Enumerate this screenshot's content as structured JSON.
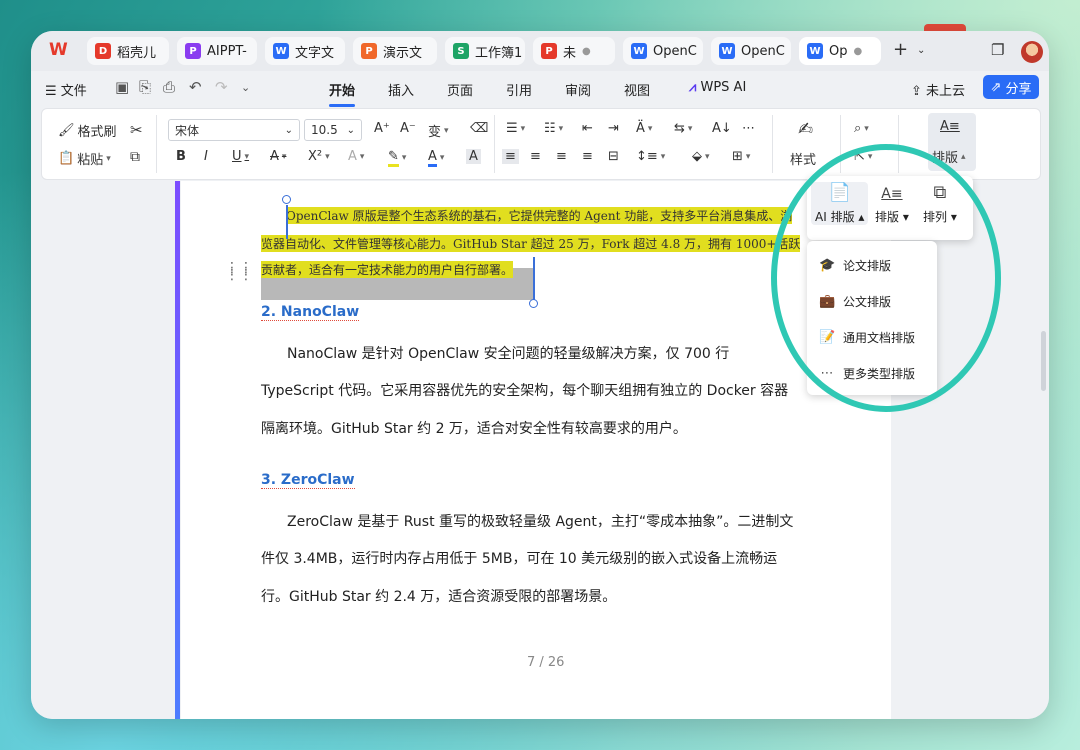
{
  "colors": {
    "accent": "#2a6cf6",
    "highlight": "#e1de1f",
    "annotation_circle": "#2fc8b4"
  },
  "tabs": [
    {
      "label": "稻壳儿",
      "icon": "docer-icon",
      "color": "#e5392b",
      "glyph": "D"
    },
    {
      "label": "AIPPT-",
      "icon": "aippt-icon",
      "color": "#8a3cf0",
      "glyph": "P"
    },
    {
      "label": "文字文",
      "icon": "writer-icon",
      "color": "#2a6cf6",
      "glyph": "W"
    },
    {
      "label": "演示文",
      "icon": "presentation-icon",
      "color": "#f0672a",
      "glyph": "P"
    },
    {
      "label": "工作簿1",
      "icon": "spreadsheet-icon",
      "color": "#1ea466",
      "glyph": "S"
    },
    {
      "label": "未",
      "icon": "pdf-icon",
      "color": "#e5392b",
      "glyph": "P"
    },
    {
      "label": "OpenC",
      "icon": "writer-icon",
      "color": "#2a6cf6",
      "glyph": "W"
    },
    {
      "label": "OpenC",
      "icon": "writer-icon",
      "color": "#2a6cf6",
      "glyph": "W"
    },
    {
      "label": "Op",
      "icon": "writer-icon",
      "color": "#2a6cf6",
      "glyph": "W"
    }
  ],
  "menubar": {
    "file": "文件",
    "items": [
      "开始",
      "插入",
      "页面",
      "引用",
      "审阅",
      "视图"
    ],
    "wps_ai": "WPS AI",
    "cloud": "未上云",
    "share": "分享"
  },
  "ribbon": {
    "format_painter": "格式刷",
    "paste": "粘贴",
    "font": "宋体",
    "font_size": "10.5",
    "style": "样式",
    "typeset": "排版"
  },
  "document": {
    "highlight_lines": [
      "OpenClaw 原版是整个生态系统的基石，它提供完整的 Agent 功能，支持多平台消息集成、浏",
      "览器自动化、文件管理等核心能力。GitHub Star 超过 25 万，Fork 超过 4.8 万，拥有 1000+活跃",
      "贡献者，适合有一定技术能力的用户自行部署。"
    ],
    "h2": "2. NanoClaw",
    "p2": [
      "NanoClaw 是针对 OpenClaw 安全问题的轻量级解决方案，仅 700 行",
      "TypeScript 代码。它采用容器优先的安全架构，每个聊天组拥有独立的 Docker 容器",
      "隔离环境。GitHub Star 约 2 万，适合对安全性有较高要求的用户。"
    ],
    "h3": "3. ZeroClaw",
    "p3": [
      "ZeroClaw 是基于 Rust 重写的极致轻量级 Agent，主打“零成本抽象”。二进制文",
      "件仅 3.4MB，运行时内存占用低于 5MB，可在 10 美元级别的嵌入式设备上流畅运",
      "行。GitHub Star 约 2.4 万，适合资源受限的部署场景。"
    ],
    "page_indicator": "7 / 26"
  },
  "typeset_panel": {
    "ai_typeset": "AI 排版",
    "typeset": "排版",
    "arrange": "排列"
  },
  "typeset_menu": [
    {
      "label": "论文排版",
      "icon": "graduation-cap-icon"
    },
    {
      "label": "公文排版",
      "icon": "briefcase-icon"
    },
    {
      "label": "通用文档排版",
      "icon": "document-edit-icon"
    },
    {
      "label": "更多类型排版",
      "icon": "more-dots-icon"
    }
  ]
}
